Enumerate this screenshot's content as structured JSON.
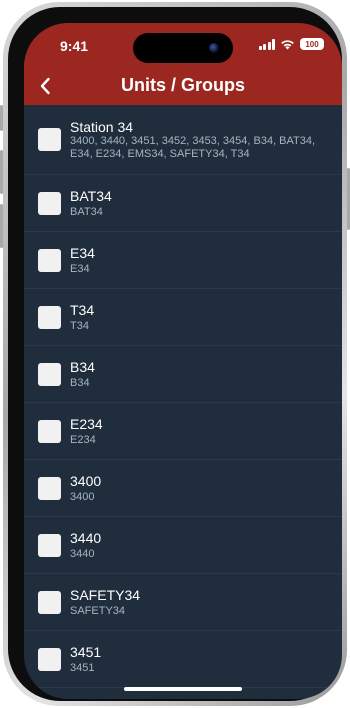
{
  "status_bar": {
    "time": "9:41",
    "battery": "100"
  },
  "header": {
    "title": "Units / Groups",
    "back_icon": "chevron-left-icon",
    "color": "#9b2720"
  },
  "units": [
    {
      "title": "Station 34",
      "subtitle": "3400, 3440, 3451, 3452, 3453, 3454, B34, BAT34, E34, E234, EMS34, SAFETY34, T34"
    },
    {
      "title": "BAT34",
      "subtitle": "BAT34"
    },
    {
      "title": "E34",
      "subtitle": "E34"
    },
    {
      "title": "T34",
      "subtitle": "T34"
    },
    {
      "title": "B34",
      "subtitle": "B34"
    },
    {
      "title": "E234",
      "subtitle": "E234"
    },
    {
      "title": "3400",
      "subtitle": "3400"
    },
    {
      "title": "3440",
      "subtitle": "3440"
    },
    {
      "title": "SAFETY34",
      "subtitle": "SAFETY34"
    },
    {
      "title": "3451",
      "subtitle": "3451"
    }
  ]
}
